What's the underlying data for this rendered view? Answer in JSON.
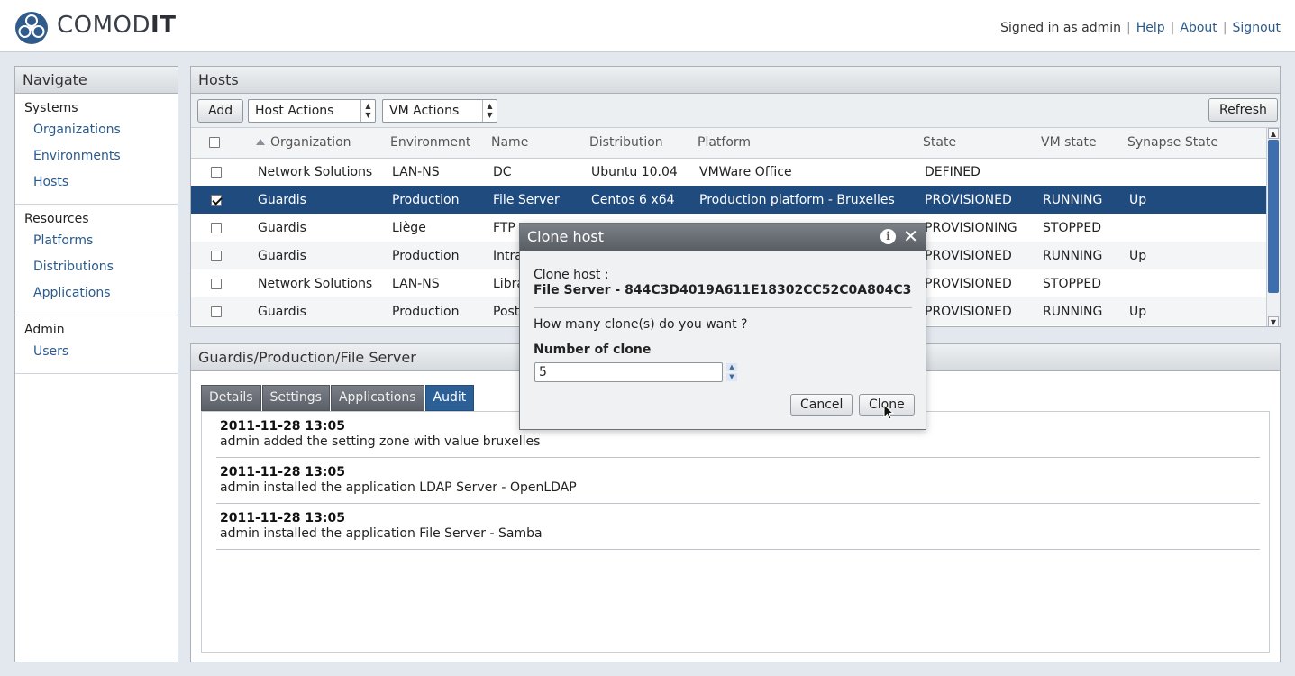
{
  "header": {
    "logo_text_light": "COMOD",
    "logo_text_bold": "IT",
    "signed_in": "Signed in as admin",
    "links": [
      "Help",
      "About",
      "Signout"
    ]
  },
  "nav": {
    "title": "Navigate",
    "sections": [
      {
        "head": "Systems",
        "items": [
          "Organizations",
          "Environments",
          "Hosts"
        ]
      },
      {
        "head": "Resources",
        "items": [
          "Platforms",
          "Distributions",
          "Applications"
        ]
      },
      {
        "head": "Admin",
        "items": [
          "Users"
        ]
      }
    ]
  },
  "hosts": {
    "title": "Hosts",
    "add_label": "Add",
    "host_actions": "Host Actions",
    "vm_actions": "VM Actions",
    "refresh_label": "Refresh",
    "columns": [
      "Organization",
      "Environment",
      "Name",
      "Distribution",
      "Platform",
      "State",
      "VM state",
      "Synapse State"
    ],
    "rows": [
      {
        "checked": false,
        "org": "Network Solutions",
        "env": "LAN-NS",
        "name": "DC",
        "dist": "Ubuntu 10.04",
        "platform": "VMWare Office",
        "state": "DEFINED",
        "vm": "",
        "syn": ""
      },
      {
        "checked": true,
        "org": "Guardis",
        "env": "Production",
        "name": "File Server",
        "dist": "Centos 6 x64",
        "platform": "Production platform - Bruxelles",
        "state": "PROVISIONED",
        "vm": "RUNNING",
        "syn": "Up"
      },
      {
        "checked": false,
        "org": "Guardis",
        "env": "Liège",
        "name": "FTP",
        "dist": "",
        "platform": "",
        "state": "PROVISIONING",
        "vm": "STOPPED",
        "syn": ""
      },
      {
        "checked": false,
        "org": "Guardis",
        "env": "Production",
        "name": "Intra",
        "dist": "",
        "platform": "",
        "state": "PROVISIONED",
        "vm": "RUNNING",
        "syn": "Up"
      },
      {
        "checked": false,
        "org": "Network Solutions",
        "env": "LAN-NS",
        "name": "Libra",
        "dist": "",
        "platform": "",
        "state": "PROVISIONED",
        "vm": "STOPPED",
        "syn": ""
      },
      {
        "checked": false,
        "org": "Guardis",
        "env": "Production",
        "name": "Post",
        "dist": "",
        "platform": "",
        "state": "PROVISIONED",
        "vm": "RUNNING",
        "syn": "Up"
      }
    ]
  },
  "detail": {
    "title": "Guardis/Production/File Server",
    "tabs": [
      "Details",
      "Settings",
      "Applications",
      "Audit"
    ],
    "active_tab": "Audit",
    "audit": [
      {
        "ts": "2011-11-28 13:05",
        "text": "admin added the setting zone with value bruxelles"
      },
      {
        "ts": "2011-11-28 13:05",
        "text": "admin installed the application LDAP Server - OpenLDAP"
      },
      {
        "ts": "2011-11-28 13:05",
        "text": "admin installed the application File Server - Samba"
      }
    ]
  },
  "modal": {
    "title": "Clone host",
    "clone_label": "Clone host :",
    "host_id": "File Server - 844C3D4019A611E18302CC52C0A804C3",
    "question": "How many clone(s) do you want ?",
    "number_label": "Number of clone",
    "number_value": "5",
    "cancel_label": "Cancel",
    "clone_button": "Clone"
  },
  "colors": {
    "selected_row": "#1f4b7e",
    "link": "#2a5a8c",
    "active_tab": "#2c5f95"
  }
}
